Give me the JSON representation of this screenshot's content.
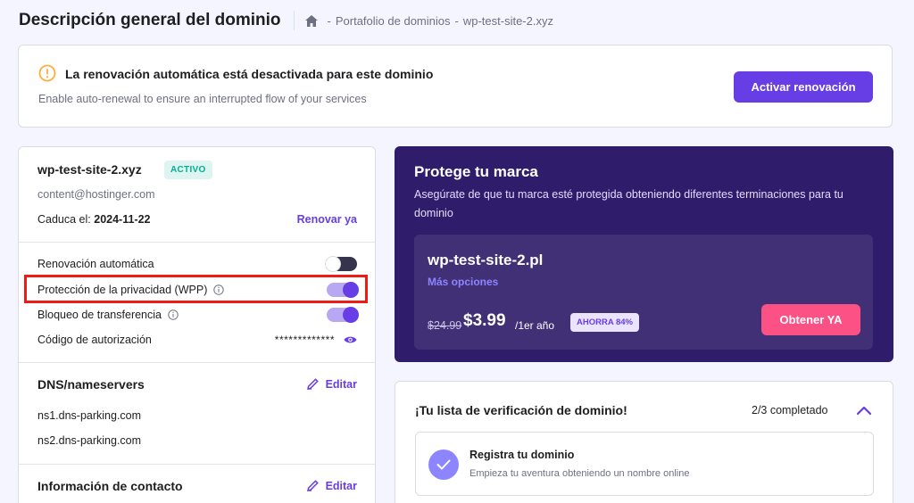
{
  "header": {
    "title": "Descripción general del dominio",
    "breadcrumb": [
      "Portafolio de dominios",
      "wp-test-site-2.xyz"
    ],
    "breadcrumb_sep": "-"
  },
  "banner": {
    "title": "La renovación automática está desactivada para este dominio",
    "subtitle": "Enable auto-renewal to ensure an interrupted flow of your services",
    "button": "Activar renovación"
  },
  "domain_card": {
    "domain": "wp-test-site-2.xyz",
    "status": "ACTIVO",
    "email": "content@hostinger.com",
    "expires_label": "Caduca el:",
    "expires_date": "2024-11-22",
    "renew_link": "Renovar ya",
    "settings": [
      {
        "label": "Renovación automática",
        "state": "off"
      },
      {
        "label": "Protección de la privacidad (WPP)",
        "state": "on",
        "info": true
      },
      {
        "label": "Bloqueo de transferencia",
        "state": "on",
        "info": true
      }
    ],
    "auth_code_label": "Código de autorización",
    "auth_code_value": "*************",
    "dns": {
      "title": "DNS/nameservers",
      "edit": "Editar",
      "nameservers": [
        "ns1.dns-parking.com",
        "ns2.dns-parking.com"
      ]
    },
    "contact": {
      "title": "Información de contacto",
      "edit": "Editar"
    }
  },
  "promo": {
    "title": "Protege tu marca",
    "subtitle": "Asegúrate de que tu marca esté protegida obteniendo diferentes terminaciones para tu dominio",
    "domain": "wp-test-site-2.pl",
    "more": "Más opciones",
    "old_price": "$24.99",
    "price": "$3.99",
    "per": "/1er año",
    "save": "AHORRA 84%",
    "button": "Obtener YA"
  },
  "checklist": {
    "title": "¡Tu lista de verificación de dominio!",
    "progress": "2/3 completado",
    "item_title": "Registra tu dominio",
    "item_subtitle": "Empieza tu aventura obteniendo un nombre online"
  },
  "colors": {
    "accent": "#673de6",
    "promo_bg": "#2f1c6a",
    "pink": "#fc5185",
    "highlight": "#ef1b14",
    "active": "#00b090"
  }
}
